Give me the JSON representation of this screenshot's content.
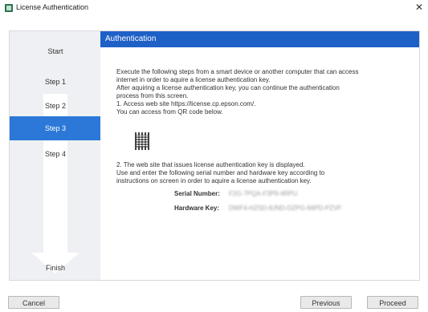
{
  "window": {
    "title": "License Authentication"
  },
  "steps": [
    {
      "label": "Start"
    },
    {
      "label": "Step 1"
    },
    {
      "label": "Step 2"
    },
    {
      "label": "Step 3"
    },
    {
      "label": "Step 4"
    },
    {
      "label": "Finish"
    }
  ],
  "active_step": "Step 3",
  "main": {
    "header": "Authentication",
    "lines1": [
      "Execute the following steps from a smart device or another computer that can access",
      "internet in order to aquire a license authentication key.",
      "After aquiring a  license authentication key, you can continue the authentication",
      "process from this screen.",
      "1. Access web site https://license.cp.epson.com/.",
      "You can access from QR code below."
    ],
    "lines2": [
      "2. The web site that issues license authentication key is displayed.",
      "Use and enter the following serial number and hardware key according to",
      "instructions on screen in order to aquire a license authentication key."
    ],
    "serial_label": "Serial Number:",
    "serial_value": "F2G-7PQA-F3P9-4RPU",
    "hardware_label": "Hardware Key:",
    "hardware_value": "DWF4-HZSD-8JND-DZPG-94PD-PZVF"
  },
  "buttons": {
    "cancel": "Cancel",
    "previous": "Previous",
    "proceed": "Proceed"
  },
  "colors": {
    "header_bg": "#1f60c7",
    "active_step_bg": "#2b78d8"
  }
}
